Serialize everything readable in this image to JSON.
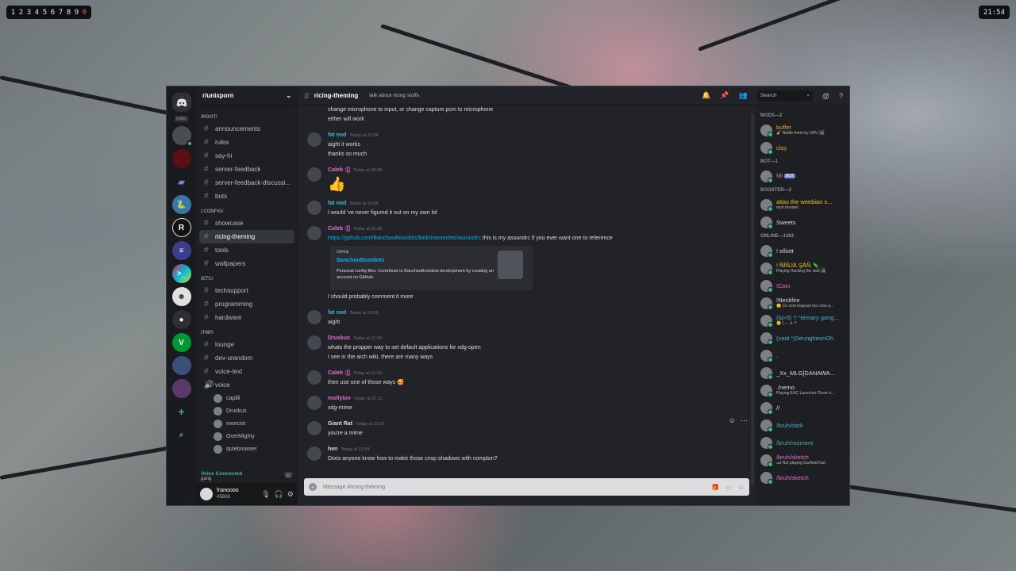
{
  "workspaces": [
    "1",
    "2",
    "3",
    "4",
    "5",
    "6",
    "7",
    "8",
    "9",
    "0"
  ],
  "current_workspace": "0",
  "clock": "21:54",
  "server_list": {
    "public_label": "public"
  },
  "guild": {
    "name": "r/unixporn"
  },
  "categories": [
    {
      "name": "/ROOT/",
      "channels": [
        "announcements",
        "rules",
        "say-hi",
        "server-feedback",
        "server-feedback-discussi...",
        "bots"
      ]
    },
    {
      "name": "/.CONFIG/",
      "channels": [
        "showcase",
        "ricing-theming",
        "tools",
        "wallpapers"
      ]
    },
    {
      "name": "/ETC/",
      "channels": [
        "techsupport",
        "programming",
        "hardware"
      ]
    },
    {
      "name": "/TMP/",
      "channels": [
        "lounge",
        "dev-urandom",
        "voice-text",
        "voice"
      ]
    }
  ],
  "voice_users": [
    "capilli",
    "Druskus",
    "exorcist",
    "OverMighty",
    "qutebrowser"
  ],
  "voice_status": {
    "status": "Voice Connected",
    "channel": "gang"
  },
  "user": {
    "name": "franoooo",
    "tag": "#5926"
  },
  "channel": {
    "name": "ricing-theming",
    "topic": "talk about ricing stuffs",
    "search_placeholder": "Search",
    "input_placeholder": "Message #ricing-theming"
  },
  "messages": [
    {
      "author": "",
      "color": "#dcddde",
      "time": "",
      "lines": [
        "change microphone to input, or change capture pcm to microphone",
        "either will work"
      ]
    },
    {
      "author": "fat nod",
      "color": "#43b5d0",
      "time": "Today at 20:38",
      "lines": [
        "aight it works",
        "thanks so much"
      ]
    },
    {
      "author": "Caleb :[]",
      "color": "#e06fd0",
      "time": "Today at 20:38",
      "emoji": "👍"
    },
    {
      "author": "fat nod",
      "color": "#43b5d0",
      "time": "Today at 20:38",
      "lines": [
        "I would 've never figured it out on my own lol"
      ]
    },
    {
      "author": "Caleb :[]",
      "color": "#e06fd0",
      "time": "Today at 20:38",
      "link": "https://github.com/BanchouBoo/dots/blob/master/etc/asoundrc",
      "after_link": " this is my asoundrc if you ever want one to reference",
      "embed": {
        "provider": "GitHub",
        "title": "BanchouBoo/dots",
        "desc": "Personal config files. Contribute to BanchouBoo/dots development by creating an account on GitHub."
      },
      "lines": [
        "I should probably comment it more"
      ]
    },
    {
      "author": "fat nod",
      "color": "#43b5d0",
      "time": "Today at 20:38",
      "lines": [
        "aight"
      ]
    },
    {
      "author": "Druskus",
      "color": "#e06fd0",
      "time": "Today at 21:09",
      "lines": [
        "whats the propper way to set default applications for xdg-open",
        "I see in the arch wiki, there are many ways"
      ]
    },
    {
      "author": "Caleb :[]",
      "color": "#e06fd0",
      "time": "Today at 21:10",
      "lines": [
        "then use one of those ways 🥰"
      ]
    },
    {
      "author": "mollytov",
      "color": "#e06fd0",
      "time": "Today at 21:12",
      "lines": [
        "xdg-mime"
      ]
    },
    {
      "author": "Giant Rat",
      "color": "#dcddde",
      "time": "Today at 21:16",
      "lines": [
        "you're a mime"
      ]
    },
    {
      "author": "hen",
      "color": "#dcddde",
      "time": "Today at 21:54",
      "lines": [
        "Does anyone know how to make those crisp shadows with compton?"
      ]
    }
  ],
  "members": [
    {
      "category": "MODS—2",
      "people": [
        {
          "name": "buffet",
          "color": "#e6a23c",
          "status": "🎸 Netflix fried my GPU 🖼"
        },
        {
          "name": "clay",
          "color": "#e6a23c",
          "status": ""
        }
      ]
    },
    {
      "category": "BOT—1",
      "people": [
        {
          "name": "Mi",
          "color": "#e06fd0",
          "status": "",
          "bot": "BOT"
        }
      ]
    },
    {
      "category": "BOOSTER—2",
      "people": [
        {
          "name": "atlas the weebian s...",
          "color": "#f1c40f",
          "status": "muh bromeri"
        },
        {
          "name": "Sweets",
          "color": "#dcddde",
          "status": ""
        }
      ]
    },
    {
      "category": "ONLINE—1363",
      "people": [
        {
          "name": "! elliott",
          "color": "#dcddde",
          "status": ""
        },
        {
          "name": "! ÑÍÑJÄ ŞÅÑ 🦎",
          "color": "#f1c40f",
          "status": "Playing Hacking the web 🖼"
        },
        {
          "name": "!Coin",
          "color": "#e06fd0",
          "status": ""
        },
        {
          "name": "!Neckfire",
          "color": "#dcddde",
          "status": "🙂 Ce sont toujours les cons q..."
        },
        {
          "name": "(iq>5) ? \"ternary gang...",
          "color": "#43b5d0",
          "status": "🌞 (·-·, ✈ ?"
        },
        {
          "name": "(void *)SeungheonOh",
          "color": "#43b5d0",
          "status": ""
        },
        {
          "name": ".",
          "color": "#dcddde",
          "status": ""
        },
        {
          "name": "_Xx_MLG[DANAWA...",
          "color": "#dcddde",
          "status": ""
        },
        {
          "name": "./nemo",
          "color": "#dcddde",
          "status": "Playing EAC Launcher Close Ic..."
        },
        {
          "name": "//",
          "color": "#dcddde",
          "status": ""
        },
        {
          "name": "/bruh/dark",
          "color": "#43b5d0",
          "status": ""
        },
        {
          "name": "/bruh/moment",
          "color": "#43b581",
          "status": ""
        },
        {
          "name": "/bruh/sketch",
          "color": "#e06fd0",
          "status": "🏎 Not playing Garfield Kart"
        },
        {
          "name": "/bruh/sketch",
          "color": "#e06fd0",
          "status": ""
        }
      ]
    }
  ]
}
